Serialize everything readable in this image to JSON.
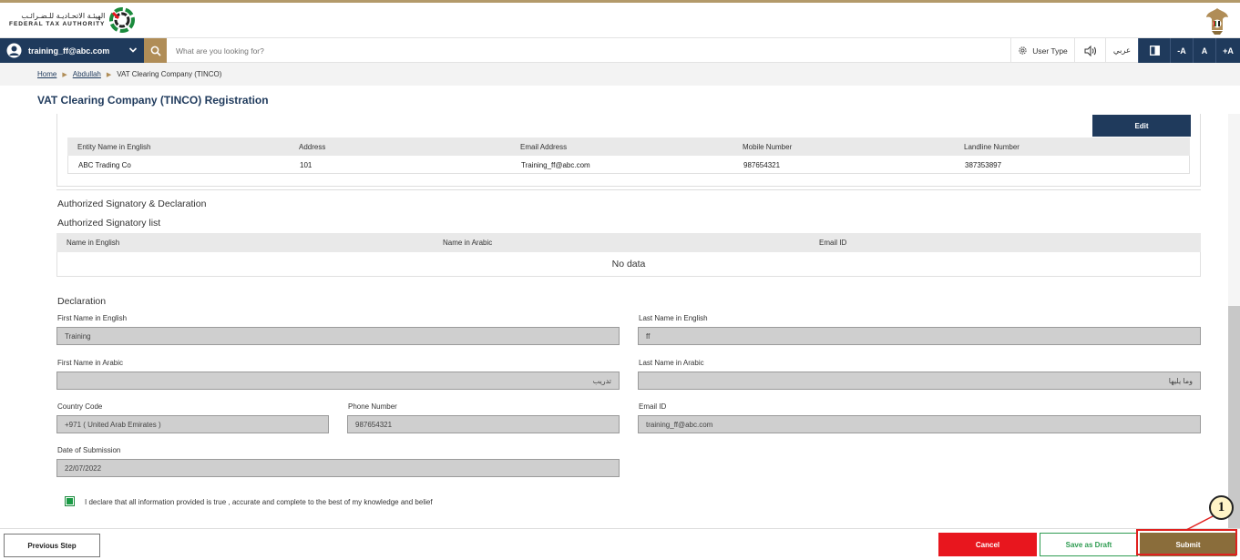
{
  "brand": {
    "logo_arabic": "الهيئـة الاتحـاديـة للـضـرائـب",
    "logo_english": "FEDERAL TAX AUTHORITY"
  },
  "colors": {
    "navy": "#1f3a5c",
    "gold": "#b08d57",
    "cancel_red": "#e8161e",
    "draft_green": "#2f9c52",
    "submit_brown": "#8a6d3b"
  },
  "navbar": {
    "user_email": "training_ff@abc.com",
    "search_placeholder": "What are you looking for?",
    "user_type": "User Type",
    "language": "عربي",
    "font_decrease": "-A",
    "font_normal": "A",
    "font_increase": "+A"
  },
  "breadcrumb": {
    "home": "Home",
    "abdullah": "Abdullah",
    "current": "VAT Clearing Company (TINCO)"
  },
  "page_title": "VAT Clearing Company (TINCO) Registration",
  "entity_table": {
    "edit_label": "Edit",
    "headers": [
      "Entity Name in English",
      "Address",
      "Email Address",
      "Mobile Number",
      "Landline Number"
    ],
    "row": [
      "ABC Trading Co",
      "101",
      "Training_ff@abc.com",
      "987654321",
      "387353897"
    ]
  },
  "signatory": {
    "section_title": "Authorized Signatory & Declaration",
    "list_title": "Authorized Signatory list",
    "headers": [
      "Name in English",
      "Name in Arabic",
      "Email ID"
    ],
    "empty_text": "No data"
  },
  "declaration": {
    "title": "Declaration",
    "first_name_en_label": "First Name in English",
    "first_name_en": "Training",
    "last_name_en_label": "Last Name in English",
    "last_name_en": "ff",
    "first_name_ar_label": "First Name in Arabic",
    "first_name_ar": "تدريب",
    "last_name_ar_label": "Last Name in Arabic",
    "last_name_ar": "وما يليها",
    "country_code_label": "Country Code",
    "country_code": "+971 ( United Arab Emirates )",
    "phone_label": "Phone Number",
    "phone": "987654321",
    "email_label": "Email ID",
    "email": "training_ff@abc.com",
    "date_label": "Date of Submission",
    "date": "22/07/2022",
    "checkbox_text": "I declare that all information provided is true , accurate and complete to the best of my knowledge and belief"
  },
  "footer": {
    "previous": "Previous Step",
    "cancel": "Cancel",
    "save_draft": "Save as Draft",
    "submit": "Submit"
  },
  "callout": {
    "number": "1"
  }
}
